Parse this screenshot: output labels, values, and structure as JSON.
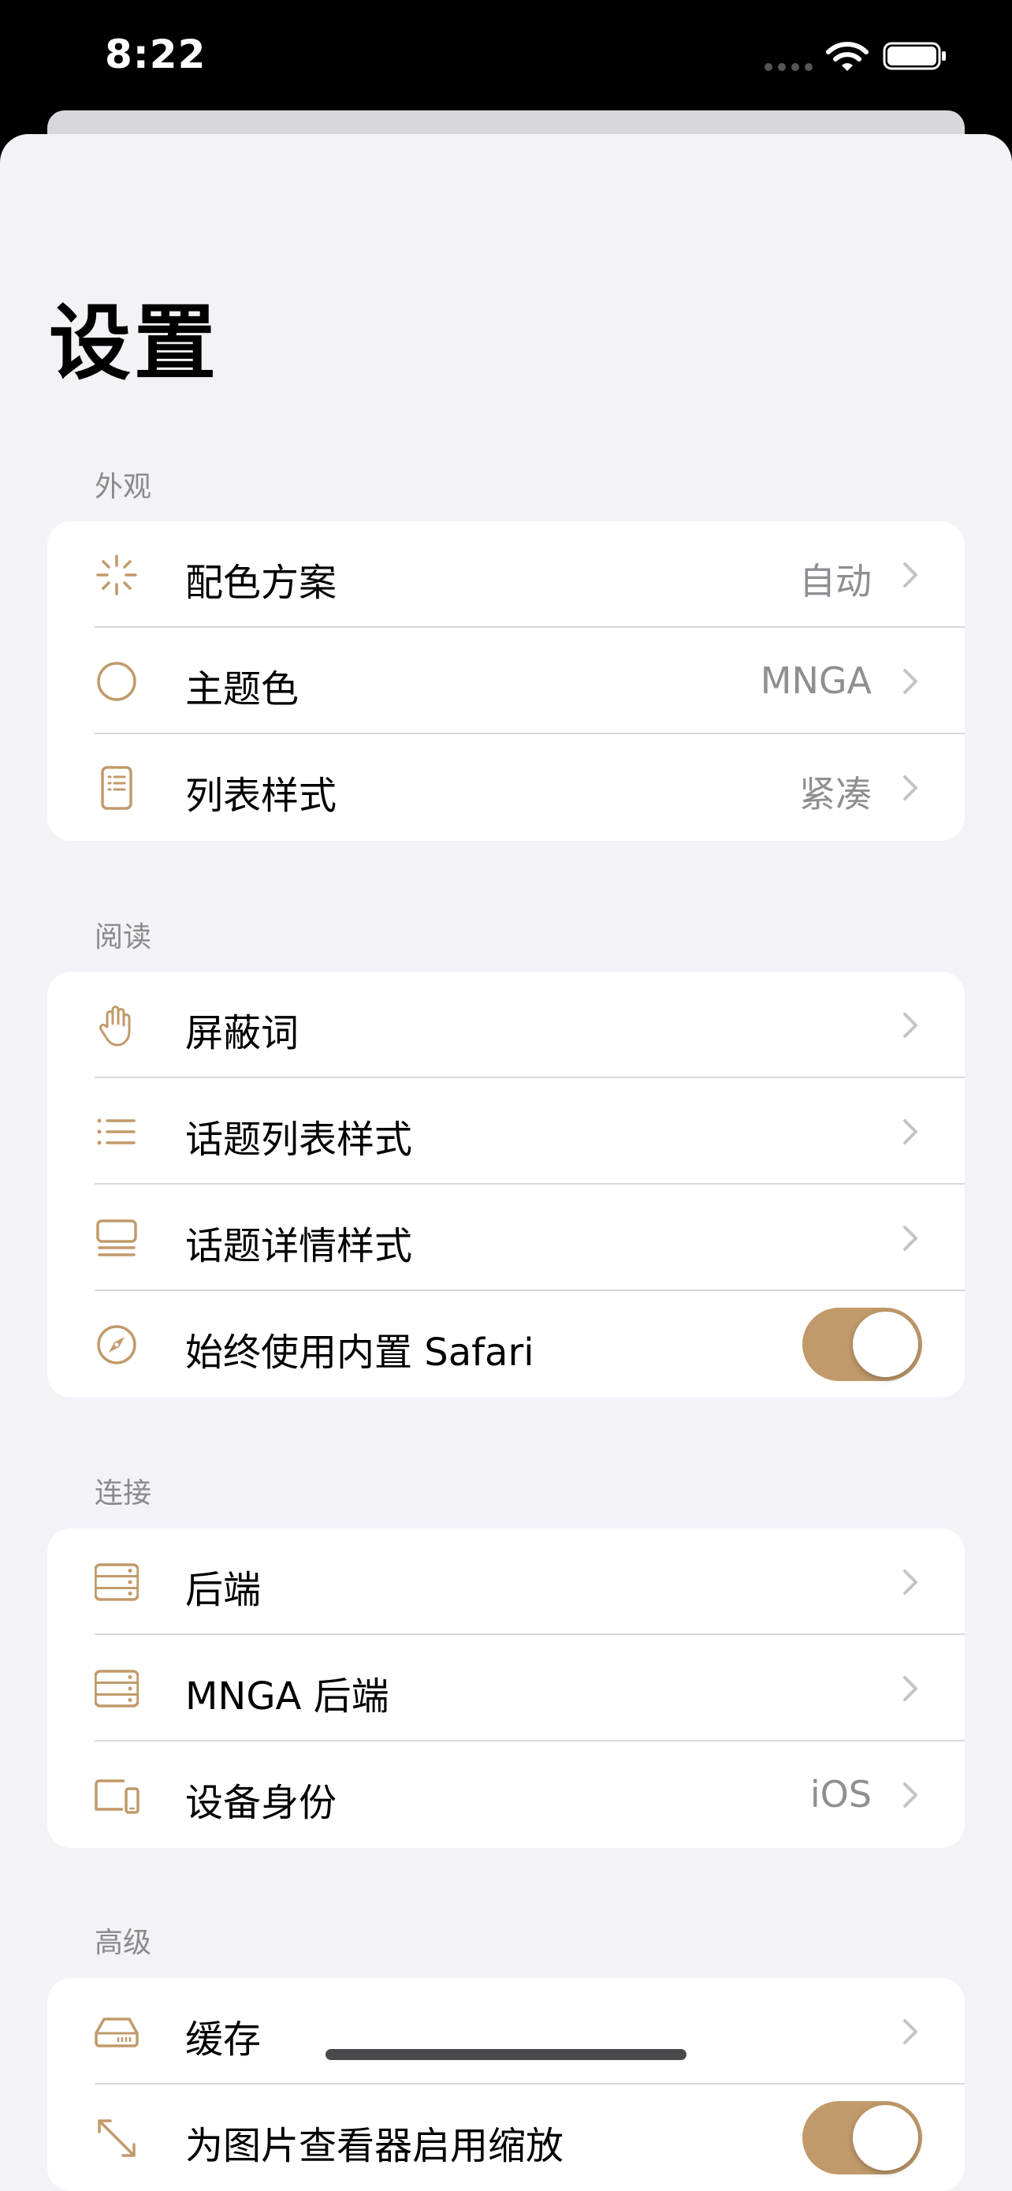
{
  "status_bar": {
    "time": "8:22"
  },
  "page": {
    "title": "设置"
  },
  "colors": {
    "accent": "#c19a6b",
    "background": "#f2f2f7",
    "secondary_text": "#8e8e93"
  },
  "sections": [
    {
      "header": "外观",
      "rows": [
        {
          "icon": "sparkle-icon",
          "label": "配色方案",
          "value": "自动",
          "control": "chevron"
        },
        {
          "icon": "circle-icon",
          "label": "主题色",
          "value": "MNGA",
          "control": "chevron"
        },
        {
          "icon": "document-list-icon",
          "label": "列表样式",
          "value": "紧凑",
          "control": "chevron"
        }
      ]
    },
    {
      "header": "阅读",
      "rows": [
        {
          "icon": "hand-raised-icon",
          "label": "屏蔽词",
          "value": "",
          "control": "chevron"
        },
        {
          "icon": "list-bullet-icon",
          "label": "话题列表样式",
          "value": "",
          "control": "chevron"
        },
        {
          "icon": "text-below-photo-icon",
          "label": "话题详情样式",
          "value": "",
          "control": "chevron"
        },
        {
          "icon": "safari-compass-icon",
          "label": "始终使用内置 Safari",
          "value": "",
          "control": "toggle",
          "on": true
        }
      ]
    },
    {
      "header": "连接",
      "rows": [
        {
          "icon": "server-rack-icon",
          "label": "后端",
          "value": "",
          "control": "chevron"
        },
        {
          "icon": "server-rack-icon",
          "label": "MNGA 后端",
          "value": "",
          "control": "chevron"
        },
        {
          "icon": "laptop-phone-icon",
          "label": "设备身份",
          "value": "iOS",
          "control": "chevron"
        }
      ]
    },
    {
      "header": "高级",
      "rows": [
        {
          "icon": "internal-drive-icon",
          "label": "缓存",
          "value": "",
          "control": "chevron"
        },
        {
          "icon": "expand-arrows-icon",
          "label": "为图片查看器启用缩放",
          "value": "",
          "control": "toggle",
          "on": true
        }
      ]
    }
  ]
}
